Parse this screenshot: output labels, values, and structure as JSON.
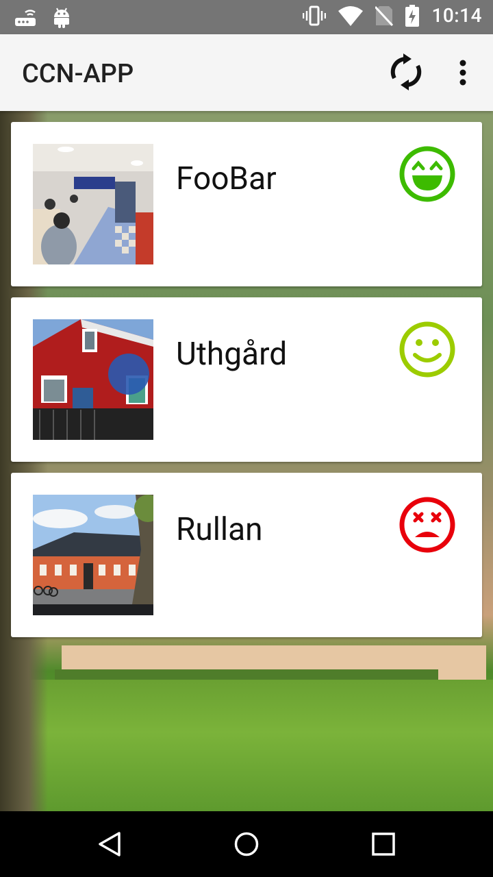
{
  "status_bar": {
    "time": "10:14",
    "icons": [
      "router-icon",
      "android-icon",
      "vibrate-icon",
      "wifi-icon",
      "no-sim-icon",
      "battery-charging-icon"
    ]
  },
  "toolbar": {
    "title": "CCN-APP",
    "actions": [
      "refresh-icon",
      "overflow-menu-icon"
    ]
  },
  "cards": [
    {
      "name": "FooBar",
      "mood": "very-happy",
      "mood_color": "#3dbb00"
    },
    {
      "name": "Uthgård",
      "mood": "happy",
      "mood_color": "#9ccc00"
    },
    {
      "name": "Rullan",
      "mood": "dead",
      "mood_color": "#e8000b"
    }
  ],
  "nav_bar": {
    "buttons": [
      "back-icon",
      "home-icon",
      "recents-icon"
    ]
  }
}
